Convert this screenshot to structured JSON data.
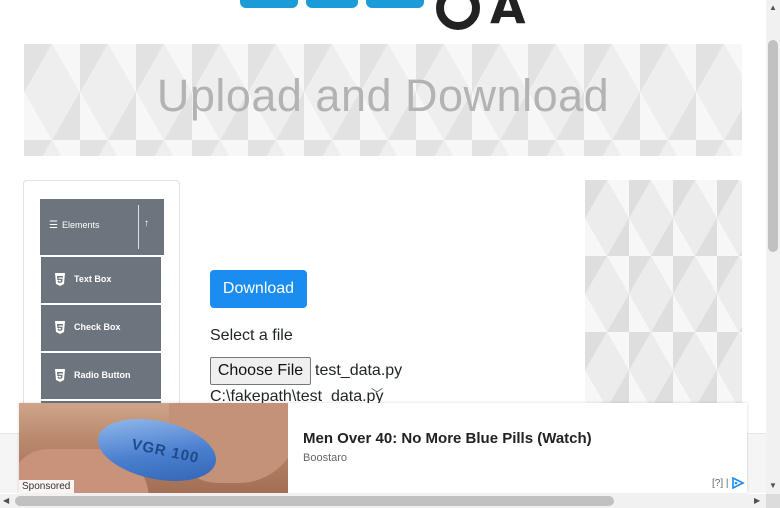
{
  "header": {
    "logo_name": "tools-qa-logo"
  },
  "banner": {
    "title": "Upload and Download"
  },
  "sidebar": {
    "group_label": "Elements",
    "group_icon": "list-icon",
    "collapse_icon": "arrow-up-icon",
    "items": [
      {
        "label": "Text Box",
        "icon": "html5-icon"
      },
      {
        "label": "Check Box",
        "icon": "html5-icon"
      },
      {
        "label": "Radio Button",
        "icon": "html5-icon"
      }
    ]
  },
  "main": {
    "download_label": "Download",
    "select_label": "Select a file",
    "choose_label": "Choose File",
    "file_name": "test_data.py",
    "file_path": "C:\\fakepath\\test_data.py"
  },
  "ad": {
    "headline": "Men Over 40: No More Blue Pills (Watch)",
    "source": "Boostaro",
    "sponsored": "Sponsored",
    "badge": "[?] |",
    "pill_text": "VGR 100"
  },
  "colors": {
    "primary": "#1b8cf0",
    "sidebar": "#6c757d",
    "banner_text": "#b3b3b3"
  }
}
